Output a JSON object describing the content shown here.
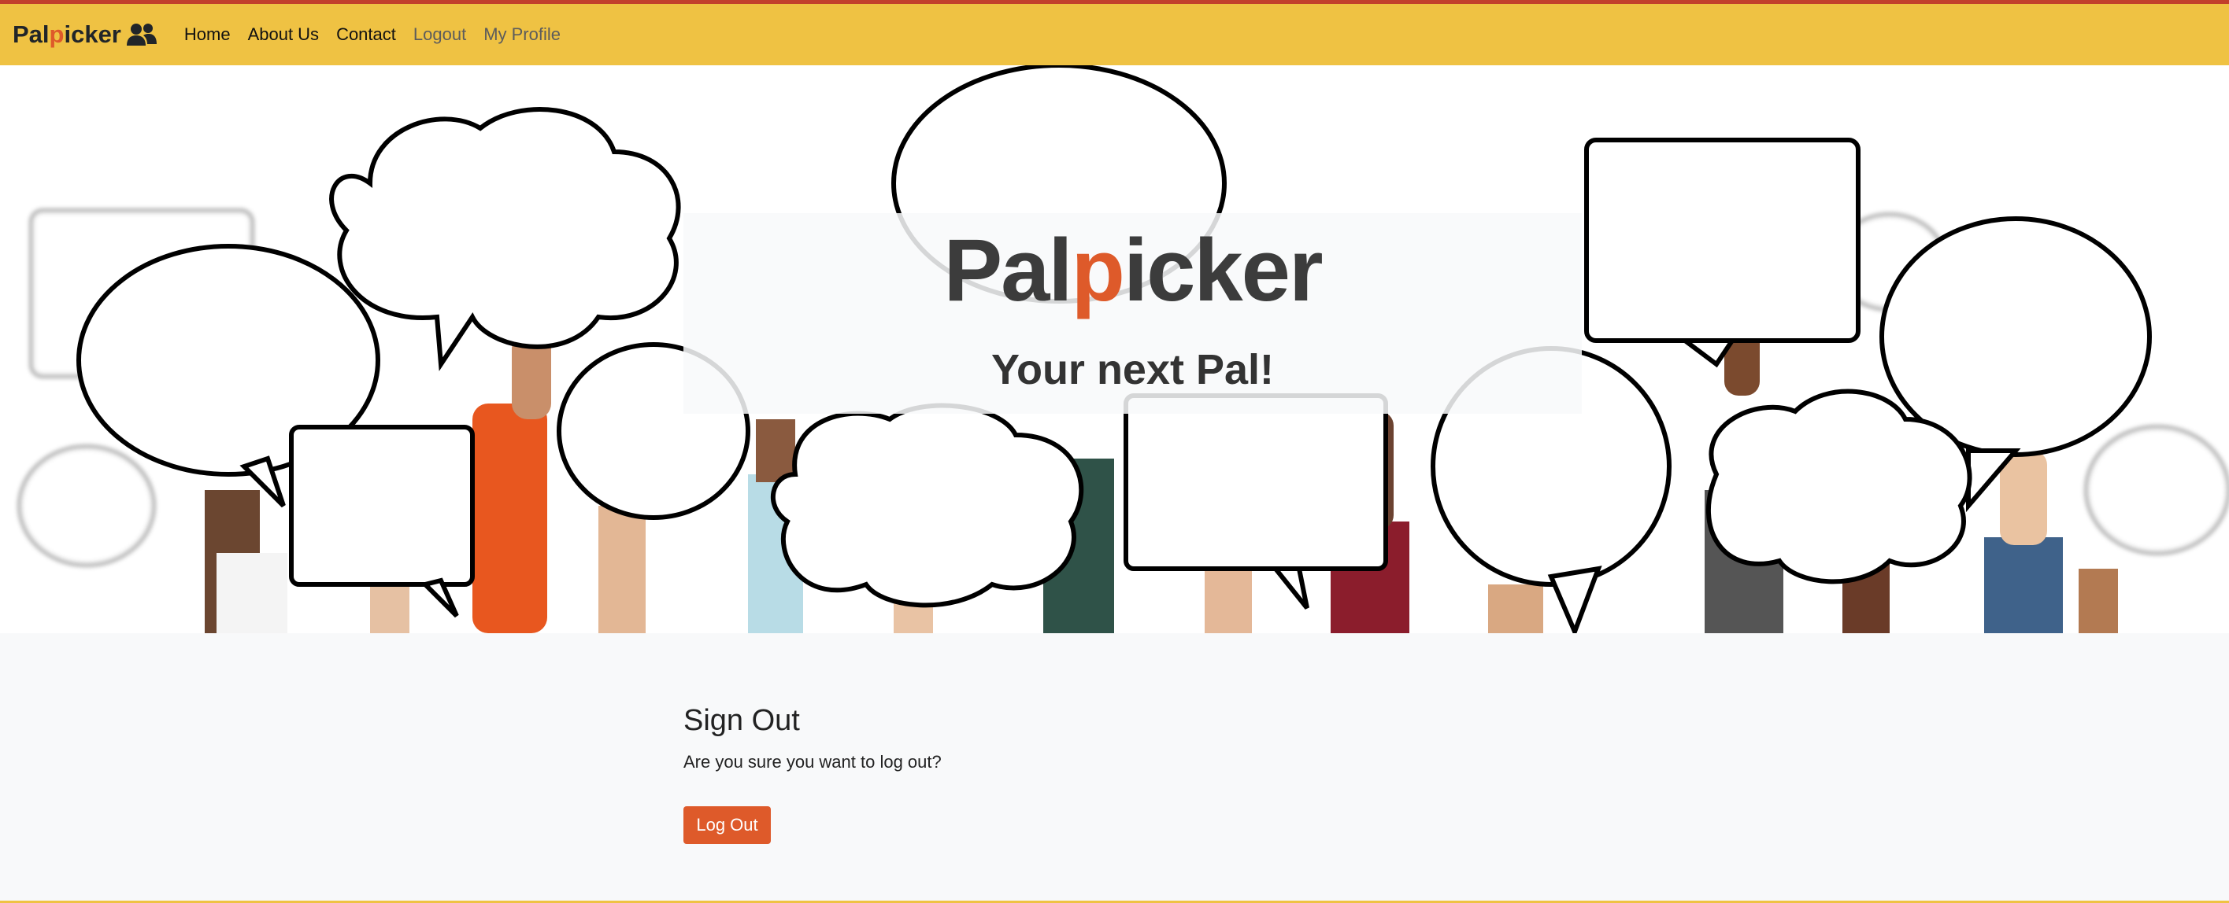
{
  "navbar": {
    "brand_prefix": "Pal",
    "brand_accent": "p",
    "brand_suffix": "icker",
    "brand_icon": "users-icon",
    "links": [
      {
        "label": "Home"
      },
      {
        "label": "About Us"
      },
      {
        "label": "Contact"
      },
      {
        "label": "Logout"
      },
      {
        "label": "My Profile"
      }
    ]
  },
  "hero": {
    "title_prefix": "Pal",
    "title_accent": "p",
    "title_suffix": "icker",
    "subtitle": "Your next Pal!"
  },
  "signout": {
    "heading": "Sign Out",
    "question": "Are you sure you want to log out?",
    "button_label": "Log Out"
  },
  "colors": {
    "navbar_bg": "#efc243",
    "accent": "#de5a2a",
    "top_border": "#c2402c",
    "page_bg": "#f8f9fa"
  }
}
